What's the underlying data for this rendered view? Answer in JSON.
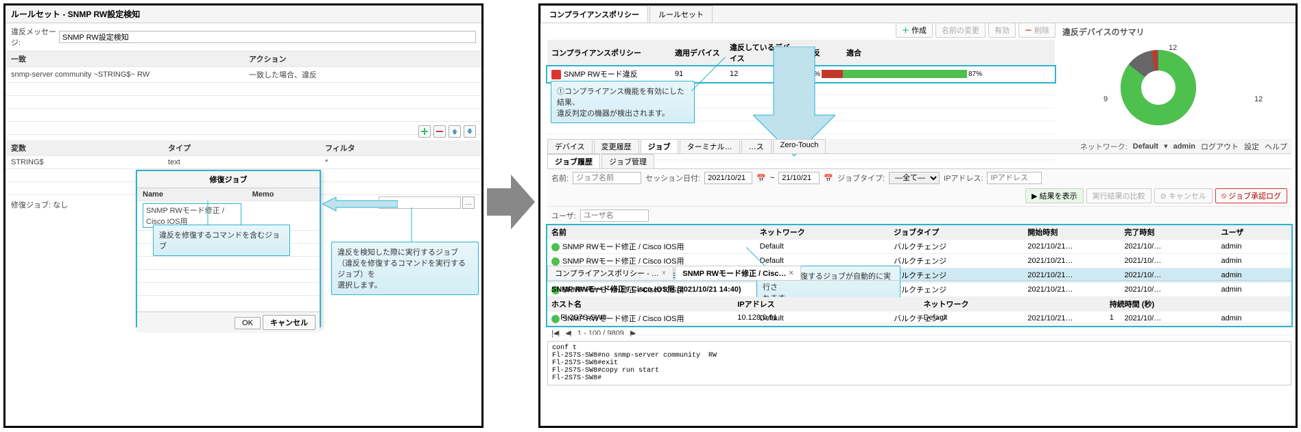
{
  "left": {
    "title": "ルールセット - SNMP RW設定検知",
    "violation_msg_label": "違反メッセージ:",
    "violation_msg_value": "SNMP RW設定検知",
    "match_table": {
      "head_match": "一致",
      "head_action": "アクション",
      "row1_match": "snmp-server community ~STRING$~ RW",
      "row1_action": "一致した場合、違反"
    },
    "var_table": {
      "head_var": "変数",
      "head_type": "タイプ",
      "head_filter": "フィルタ",
      "row1_var": "STRING$",
      "row1_type": "text",
      "row1_filter": "*"
    },
    "fix_job_label": "修復ジョブ:",
    "fix_job_value": "なし",
    "dialog": {
      "title": "修復ジョブ",
      "col_name": "Name",
      "col_memo": "Memo",
      "row1_name": "SNMP RWモード修正 / Cisco IOS用",
      "ok": "OK",
      "cancel": "キャンセル"
    },
    "callout1": "違反を修復するコマンドを含むジョブ",
    "callout2_l1": "違反を検知した際に実行するジョブ",
    "callout2_l2": "（違反を修復するコマンドを実行するジョブ）を",
    "callout2_l3": "選択します。"
  },
  "right": {
    "tab1": "コンプライアンスポリシー",
    "tab2": "ルールセット",
    "tb_create": "作成",
    "tb_rename": "名前の変更",
    "tb_enable": "有効",
    "tb_delete": "削除",
    "summary_title": "違反デバイスのサマリ",
    "comp_table": {
      "h1": "コンプライアンスポリシー",
      "h2": "適用デバイス",
      "h3": "違反しているデバイス",
      "h4": "違反",
      "h5": "適合",
      "r_name": "SNMP RWモード違反",
      "r_applied": "91",
      "r_viol": "12",
      "r_viol_pct": "13%",
      "r_ok_pct": "87%"
    },
    "chart": {
      "v1": "12",
      "v2": "12",
      "v3": "9"
    },
    "callout1_l1": "①コンプライアンス機能を有効にした結果、",
    "callout1_l2": "違反判定の機器が検出されます。",
    "mid_tabs": {
      "t1": "デバイス",
      "t2": "変更履歴",
      "t3": "ジョブ",
      "t4": "ターミナル…",
      "t5": "…ス",
      "t6": "Zero-Touch"
    },
    "mid_top": {
      "net_label": "ネットワーク:",
      "net_value": "Default",
      "user": "admin",
      "logout": "ログアウト",
      "settings": "設定",
      "help": "ヘルプ"
    },
    "subtab1": "ジョブ履歴",
    "subtab2": "ジョブ管理",
    "filters": {
      "name_lbl": "名前:",
      "name_ph": "ジョブ名前",
      "session_lbl": "セッション日付:",
      "date1": "2021/10/21",
      "to": "~",
      "date2": "21/10/21",
      "jobtype_lbl": "ジョブタイプ:",
      "jobtype_val": "―全て―",
      "user_lbl": "ユーザ:",
      "user_ph": "ユーザ名",
      "ip_lbl": "IPアドレス:",
      "ip_ph": "IPアドレス",
      "btn_show": "結果を表示",
      "btn_compare": "実行結果の比較",
      "btn_cancel": "キャンセル",
      "btn_approve": "ジョブ承認ログ"
    },
    "job_table": {
      "h1": "名前",
      "h2": "ネットワーク",
      "h3": "ジョブタイプ",
      "h4": "開始時刻",
      "h5": "完了時刻",
      "h6": "ユーザ",
      "name": "SNMP RWモード修正 / Cisco IOS用",
      "net": "Default",
      "type": "バルクチェンジ",
      "start": "2021/10/21…",
      "end": "2021/10/…",
      "user": "admin"
    },
    "pager": {
      "nav_first": "|◀",
      "nav_prev": "◀",
      "range": "1 - 100 / 9809",
      "nav_next": "▶"
    },
    "callout2_l1": "②違反を修復するジョブが自動的に実行さ",
    "callout2_l2": "れます。",
    "detail": {
      "tab1": "コンプライアンスポリシー - …",
      "tab2": "SNMP RWモード修正 / Cisc…",
      "title": "SNMP RWモード修正 / Cisco IOS用 (2021/10/21 14:40)",
      "h1": "ホスト名",
      "h2": "IPアドレス",
      "h3": "ネットワーク",
      "h4": "持続時間 (秒)",
      "r_host": "Fl-2S7S-SW8",
      "r_ip": "10.128.0.91",
      "r_net": "Default",
      "r_dur": "1"
    },
    "console": "conf t\nFl-2S7S-SW8#no snmp-server community  RW\nFl-2S7S-SW8#exit\nFl-2S7S-SW8#copy run start\nFl-2S7S-SW8#"
  }
}
